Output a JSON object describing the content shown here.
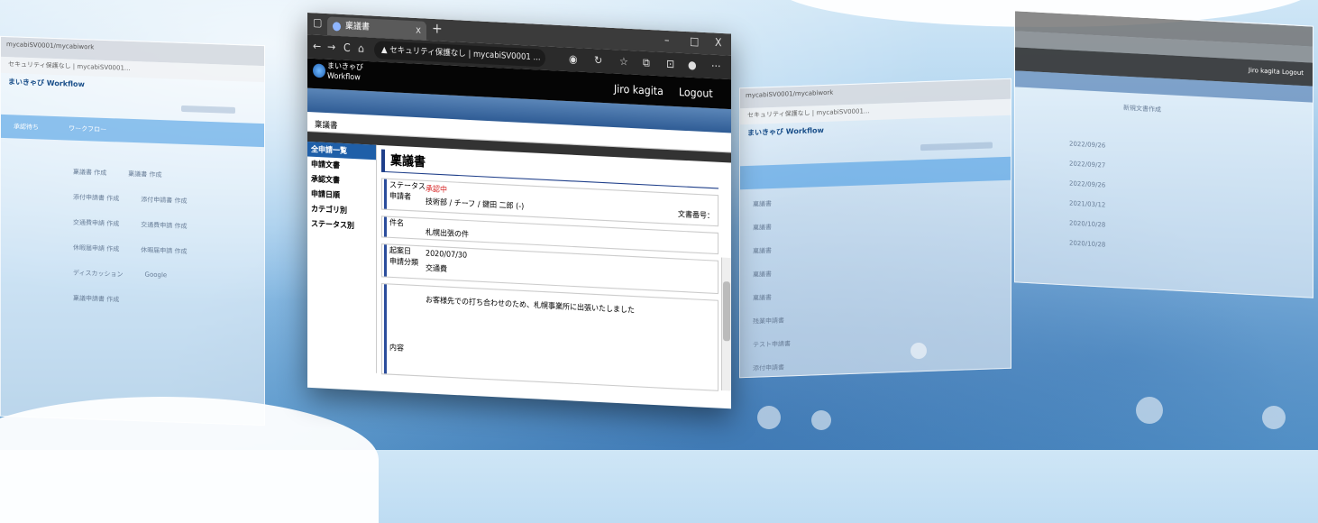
{
  "background_windows": {
    "left": {
      "tab_title": "mycabiSV0001/mycabiwork",
      "address": "セキュリティ保護なし | mycabiSV0001...",
      "logo": "まいきゃび Workflow",
      "side_label": "承認待ち",
      "blue_bar_label": "ワークフロー",
      "items": [
        "稟議書 作成",
        "稟議書 作成",
        "添付申請書 作成",
        "添付申請書 作成",
        "交通費申請 作成",
        "交通費申請 作成",
        "休暇届申請 作成",
        "休暇届申請 作成",
        "ディスカッション",
        "Google",
        "稟議申請書 作成"
      ]
    },
    "middle": {
      "tab_title": "mycabiSV0001/mycabiwork",
      "address": "セキュリティ保護なし | mycabiSV0001...",
      "logo": "まいきゃび Workflow",
      "rows": [
        "稟議書",
        "稟議書",
        "稟議書",
        "稟議書",
        "稟議書",
        "残業申請書",
        "テスト申請書",
        "添付申請書"
      ]
    },
    "right": {
      "user": "Jiro kagita",
      "logout": "Logout",
      "title": "新規文書作成",
      "rows": [
        "2022/09/26",
        "2022/09/27",
        "2022/09/26",
        "2021/03/12",
        "2020/10/28",
        "2020/10/28"
      ]
    }
  },
  "browser": {
    "tab_title": "稟議書",
    "tab_close": "x",
    "new_tab": "+",
    "win_min": "–",
    "win_max": "□",
    "win_close": "X",
    "nav_back": "←",
    "nav_forward": "→",
    "nav_reload": "C",
    "nav_home": "⌂",
    "security_warning": "▲ セキュリティ保護なし",
    "url": "mycabiSV0001 ...",
    "more": "···"
  },
  "app": {
    "logo_line1": "まいきゃび",
    "logo_line2": "Workflow",
    "user_name": "Jiro kagita",
    "logout": "Logout",
    "breadcrumb": "稟議書"
  },
  "sidebar": {
    "items": [
      "全申請一覧",
      "申請文書",
      "承認文書",
      "申請日順",
      "カテゴリ別",
      "ステータス別"
    ]
  },
  "document": {
    "title": "稟議書",
    "status_label": "ステータス",
    "status_value": "承認中",
    "applicant_label": "申請者",
    "applicant_value": "技術部 / チーフ / 鍵田 二郎 (-)",
    "docno_label": "文書番号：",
    "subject_label": "件名",
    "subject_value": "札幌出張の件",
    "date_label": "起案日",
    "date_value": "2020/07/30",
    "category_label": "申請分類",
    "category_value": "交通費",
    "content_label": "内容",
    "content_value": "お客様先での打ち合わせのため、札幌事業所に出張いたしました"
  }
}
